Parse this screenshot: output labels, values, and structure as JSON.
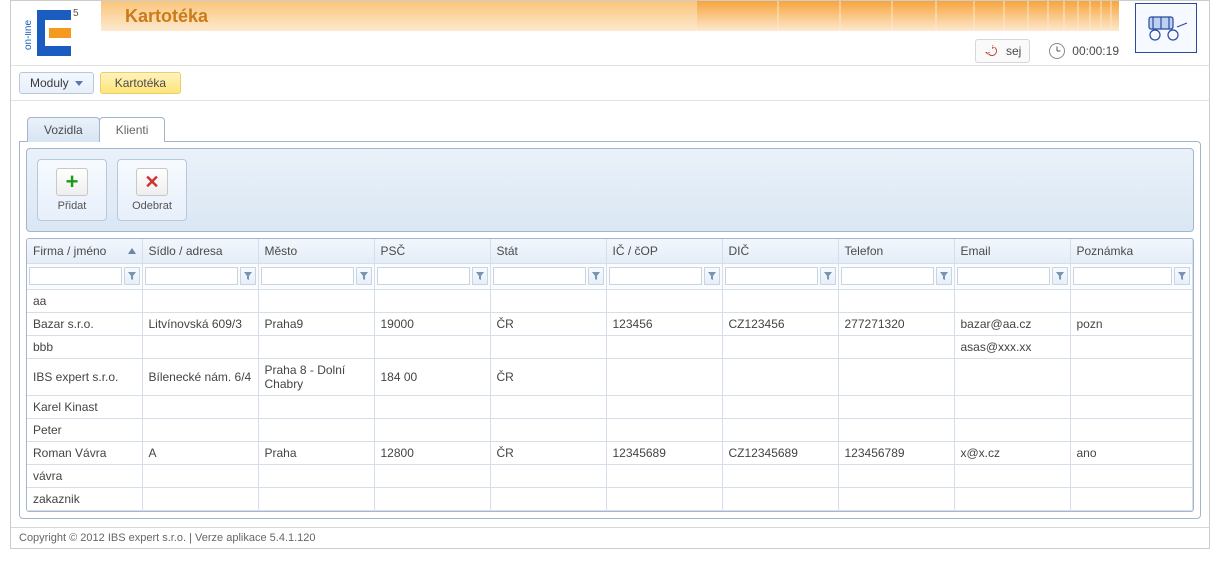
{
  "header": {
    "title": "Kartotéka",
    "status_label": "sej",
    "timer": "00:00:19"
  },
  "menu": {
    "moduly": "Moduly",
    "crumb": "Kartotéka"
  },
  "tabs": {
    "vozidla": "Vozidla",
    "klienti": "Klienti"
  },
  "toolbar": {
    "add": "Přidat",
    "remove": "Odebrat"
  },
  "grid": {
    "headers": {
      "firma": "Firma / jméno",
      "sidlo": "Sídlo / adresa",
      "mesto": "Město",
      "psc": "PSČ",
      "stat": "Stát",
      "ic": "IČ / čOP",
      "dic": "DIČ",
      "telefon": "Telefon",
      "email": "Email",
      "poznamka": "Poznámka"
    },
    "rows": [
      {
        "firma": "aa",
        "sidlo": "",
        "mesto": "",
        "psc": "",
        "stat": "",
        "ic": "",
        "dic": "",
        "telefon": "",
        "email": "",
        "poznamka": ""
      },
      {
        "firma": "Bazar s.r.o.",
        "sidlo": "Litvínovská 609/3",
        "mesto": "Praha9",
        "psc": "19000",
        "stat": "ČR",
        "ic": "123456",
        "dic": "CZ123456",
        "telefon": "277271320",
        "email": "bazar@aa.cz",
        "poznamka": "pozn"
      },
      {
        "firma": "bbb",
        "sidlo": "",
        "mesto": "",
        "psc": "",
        "stat": "",
        "ic": "",
        "dic": "",
        "telefon": "",
        "email": "asas@xxx.xx",
        "poznamka": ""
      },
      {
        "firma": "IBS expert s.r.o.",
        "sidlo": "Bílenecké nám. 6/4",
        "mesto": "Praha 8 - Dolní Chabry",
        "psc": "184 00",
        "stat": "ČR",
        "ic": "",
        "dic": "",
        "telefon": "",
        "email": "",
        "poznamka": ""
      },
      {
        "firma": "Karel Kinast",
        "sidlo": "",
        "mesto": "",
        "psc": "",
        "stat": "",
        "ic": "",
        "dic": "",
        "telefon": "",
        "email": "",
        "poznamka": ""
      },
      {
        "firma": "Peter",
        "sidlo": "",
        "mesto": "",
        "psc": "",
        "stat": "",
        "ic": "",
        "dic": "",
        "telefon": "",
        "email": "",
        "poznamka": ""
      },
      {
        "firma": "Roman Vávra",
        "sidlo": "A",
        "mesto": "Praha",
        "psc": "12800",
        "stat": "ČR",
        "ic": "12345689",
        "dic": "CZ12345689",
        "telefon": "123456789",
        "email": "x@x.cz",
        "poznamka": "ano"
      },
      {
        "firma": "vávra",
        "sidlo": "",
        "mesto": "",
        "psc": "",
        "stat": "",
        "ic": "",
        "dic": "",
        "telefon": "",
        "email": "",
        "poznamka": ""
      },
      {
        "firma": "zakaznik",
        "sidlo": "",
        "mesto": "",
        "psc": "",
        "stat": "",
        "ic": "",
        "dic": "",
        "telefon": "",
        "email": "",
        "poznamka": ""
      }
    ]
  },
  "footer": {
    "copyright": "Copyright © 2012 IBS expert s.r.o. | Verze aplikace 5.4.1.120"
  }
}
